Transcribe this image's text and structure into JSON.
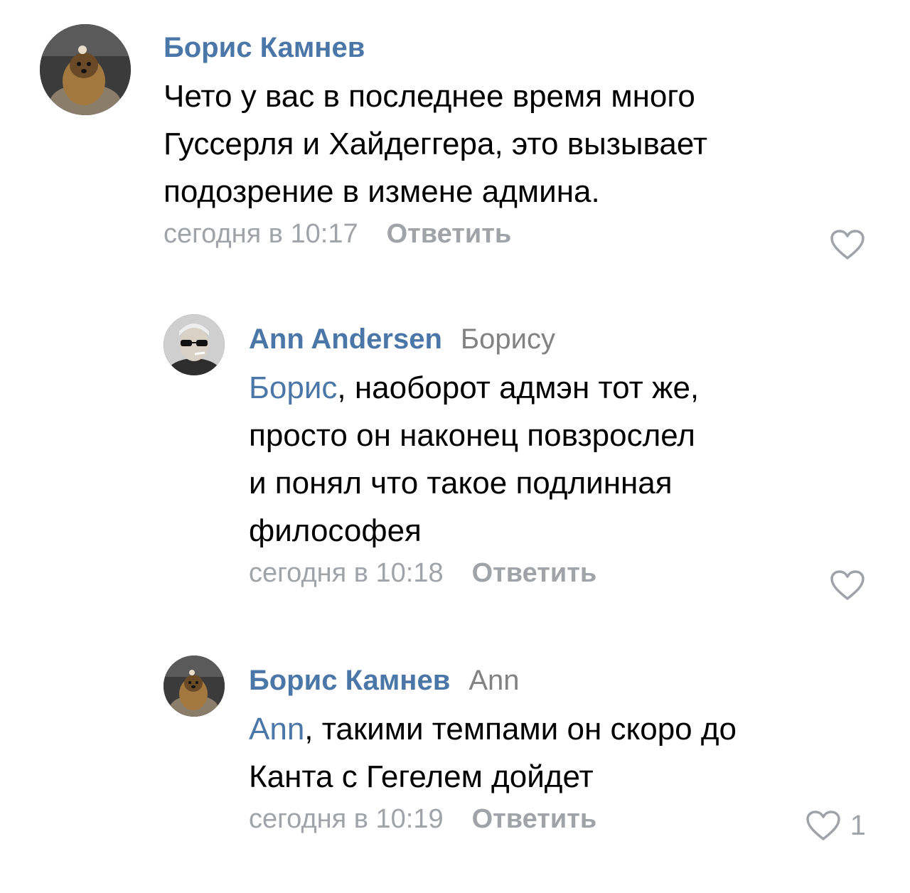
{
  "comments": [
    {
      "author": "Борис Камнев",
      "reply_to": "",
      "mention": "",
      "lines": [
        "Чето у вас в последнее время много",
        "Гуссерля и Хайдеггера, это вызывает",
        "подозрение в измене админа."
      ],
      "time": "сегодня в 10:17",
      "reply_label": "Ответить",
      "likes": "",
      "avatar_icon": "yorkshire-terrier-photo"
    },
    {
      "author": "Ann Andersen",
      "reply_to": "Борису",
      "mention": "Борис",
      "lines": [
        ", наоборот адмэн тот же,",
        "просто он наконец повзрослел",
        "и понял что такое подлинная",
        "философея"
      ],
      "time": "сегодня в 10:18",
      "reply_label": "Ответить",
      "likes": "",
      "avatar_icon": "person-sunglasses-photo"
    },
    {
      "author": "Борис Камнев",
      "reply_to": "Ann",
      "mention": "Ann",
      "lines": [
        ", такими темпами он скоро до",
        "Канта с Гегелем дойдет"
      ],
      "time": "сегодня в 10:19",
      "reply_label": "Ответить",
      "likes": "1",
      "avatar_icon": "yorkshire-terrier-photo"
    }
  ],
  "colors": {
    "link": "#4a76a8",
    "secondary": "#828282",
    "meta": "#a0a3a7"
  }
}
